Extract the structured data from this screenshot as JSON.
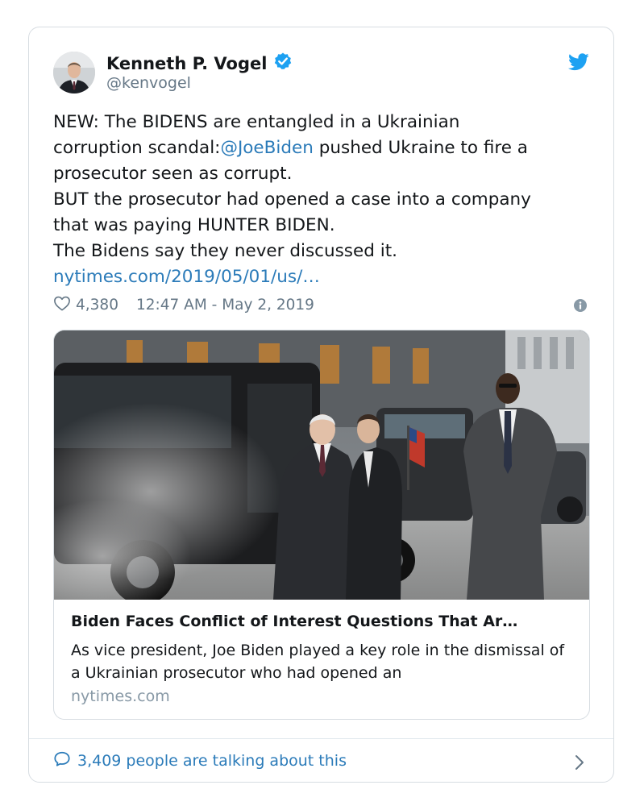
{
  "author": {
    "name": "Kenneth P. Vogel",
    "handle": "@kenvogel",
    "verified": true
  },
  "tweet": {
    "lines": [
      [
        "NEW: The BIDENS are entangled in a Ukrainian"
      ],
      [
        "corruption scandal:",
        "@JoeBiden",
        " pushed Ukraine to fire a"
      ],
      [
        "prosecutor seen as corrupt."
      ],
      [
        "BUT the prosecutor had opened a case into a company"
      ],
      [
        "that was paying HUNTER BIDEN."
      ],
      [
        "The Bidens say they never discussed it."
      ],
      [
        "nytimes.com/2019/05/01/us/…"
      ]
    ]
  },
  "meta": {
    "likes": "4,380",
    "timestamp": "12:47 AM - May 2, 2019"
  },
  "link_preview": {
    "title": "Biden Faces Conflict of Interest Questions That Ar…",
    "description": "As vice president, Joe Biden played a key role in the dismissal of a Ukrainian prosecutor who had opened an",
    "domain": "nytimes.com"
  },
  "footer": {
    "talking": "3,409 people are talking about this"
  },
  "icons": {
    "verified": "verified-badge-icon",
    "brand": "twitter-bird-icon",
    "like": "heart-icon",
    "info": "info-icon",
    "reply": "speech-bubble-icon",
    "chevron": "chevron-right-icon"
  },
  "colors": {
    "link": "#2b7bb9",
    "verified": "#1da1f2",
    "muted": "#657786",
    "border": "#d7dde2"
  }
}
